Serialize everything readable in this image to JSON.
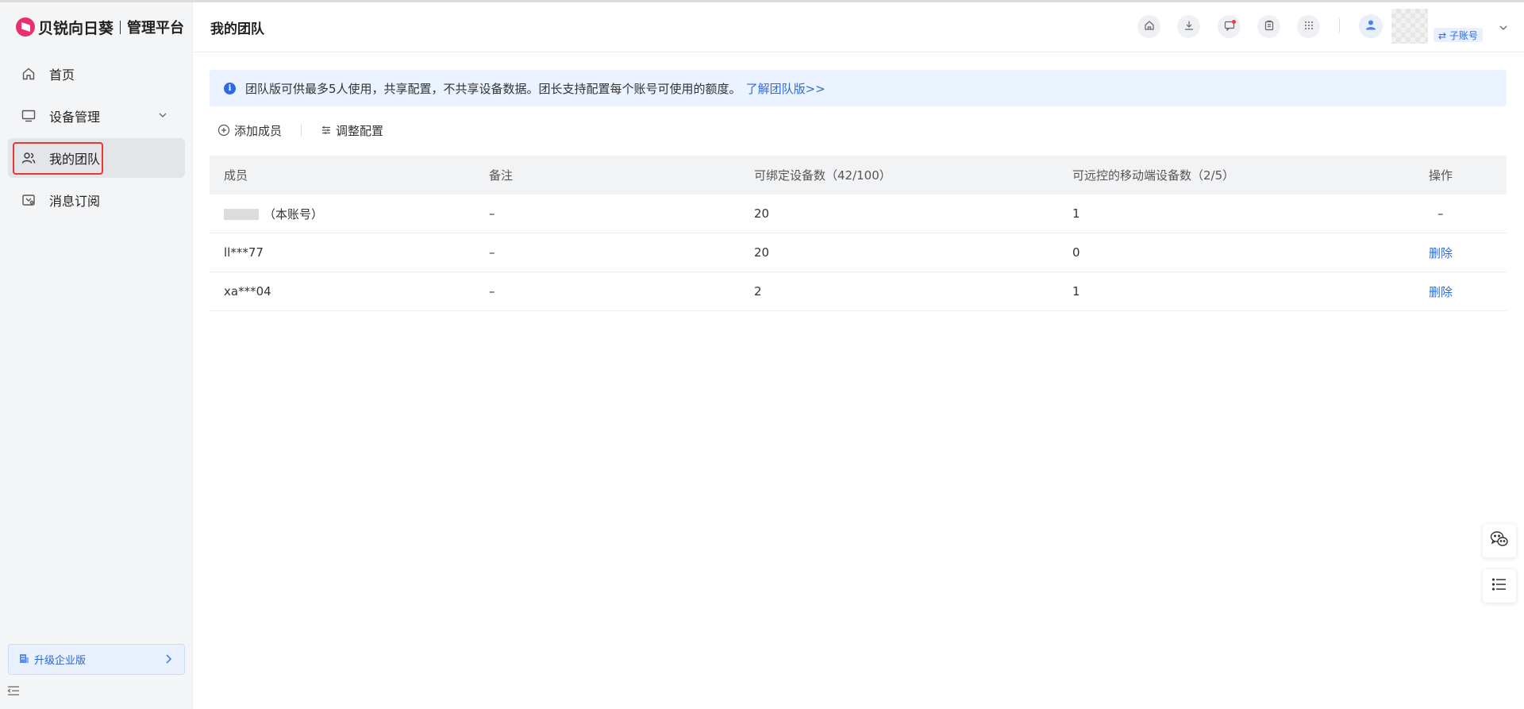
{
  "brand": {
    "name": "贝锐向日葵",
    "platform": "管理平台"
  },
  "sidebar": {
    "items": [
      {
        "label": "首页",
        "icon": "home-icon"
      },
      {
        "label": "设备管理",
        "icon": "monitor-icon"
      },
      {
        "label": "我的团队",
        "icon": "team-icon",
        "active": true
      },
      {
        "label": "消息订阅",
        "icon": "subscribe-icon"
      }
    ],
    "upgrade_label": "升级企业版"
  },
  "header": {
    "title": "我的团队",
    "sub_account_label": "⇄ 子账号"
  },
  "notice": {
    "text": "团队版可供最多5人使用，共享配置，不共享设备数据。团长支持配置每个账号可使用的额度。",
    "link": "了解团队版>>"
  },
  "toolbar": {
    "add_member": "添加成员",
    "adjust_config": "调整配置"
  },
  "table": {
    "headers": [
      "成员",
      "备注",
      "可绑定设备数（42/100）",
      "可远控的移动端设备数（2/5）",
      "操作"
    ],
    "rows": [
      {
        "member_suffix": "（本账号）",
        "note": "–",
        "bindable": "20",
        "mobile": "1",
        "action": "–"
      },
      {
        "member": "ll***77",
        "note": "–",
        "bindable": "20",
        "mobile": "0",
        "action": "删除"
      },
      {
        "member": "xa***04",
        "note": "–",
        "bindable": "2",
        "mobile": "1",
        "action": "删除"
      }
    ]
  },
  "colors": {
    "accent": "#2f6be0",
    "highlight": "#e53935",
    "brand": "#e8306a"
  }
}
